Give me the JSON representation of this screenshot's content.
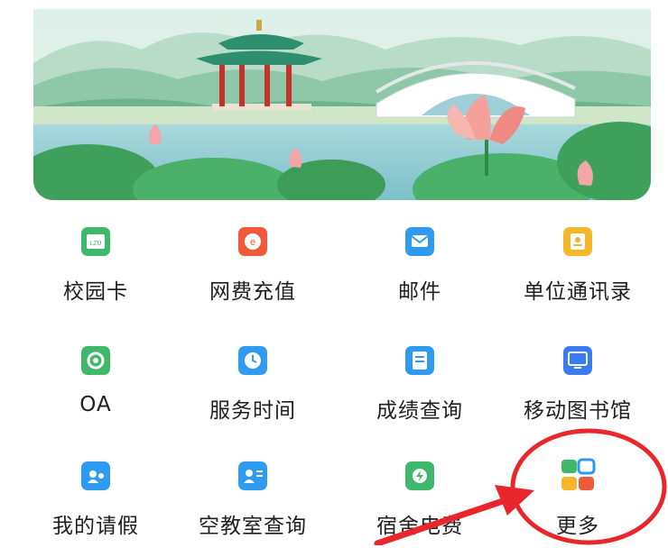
{
  "colors": {
    "accent_red": "#e8262b",
    "text": "#1f1f1f"
  },
  "tiles": [
    {
      "label": "校园卡",
      "icon": "campus-card-icon",
      "color": "#3fb86b"
    },
    {
      "label": "网费充值",
      "icon": "network-fee-icon",
      "color": "#f05a3a"
    },
    {
      "label": "邮件",
      "icon": "mail-icon",
      "color": "#2f9bf0"
    },
    {
      "label": "单位通讯录",
      "icon": "address-book-icon",
      "color": "#f4b72a"
    },
    {
      "label": "OA",
      "icon": "oa-icon",
      "color": "#3fb86b"
    },
    {
      "label": "服务时间",
      "icon": "clock-icon",
      "color": "#2f9bf0"
    },
    {
      "label": "成绩查询",
      "icon": "grade-query-icon",
      "color": "#2f9bf0"
    },
    {
      "label": "移动图书馆",
      "icon": "library-icon",
      "color": "#3a7cf0"
    },
    {
      "label": "我的请假",
      "icon": "leave-request-icon",
      "color": "#2f9bf0"
    },
    {
      "label": "空教室查询",
      "icon": "empty-classroom-icon",
      "color": "#2f9bf0"
    },
    {
      "label": "宿舍电费",
      "icon": "dorm-electricity-icon",
      "color": "#3fb86b"
    },
    {
      "label": "更多",
      "icon": "more-grid-icon",
      "color": "#3fb86b"
    }
  ]
}
